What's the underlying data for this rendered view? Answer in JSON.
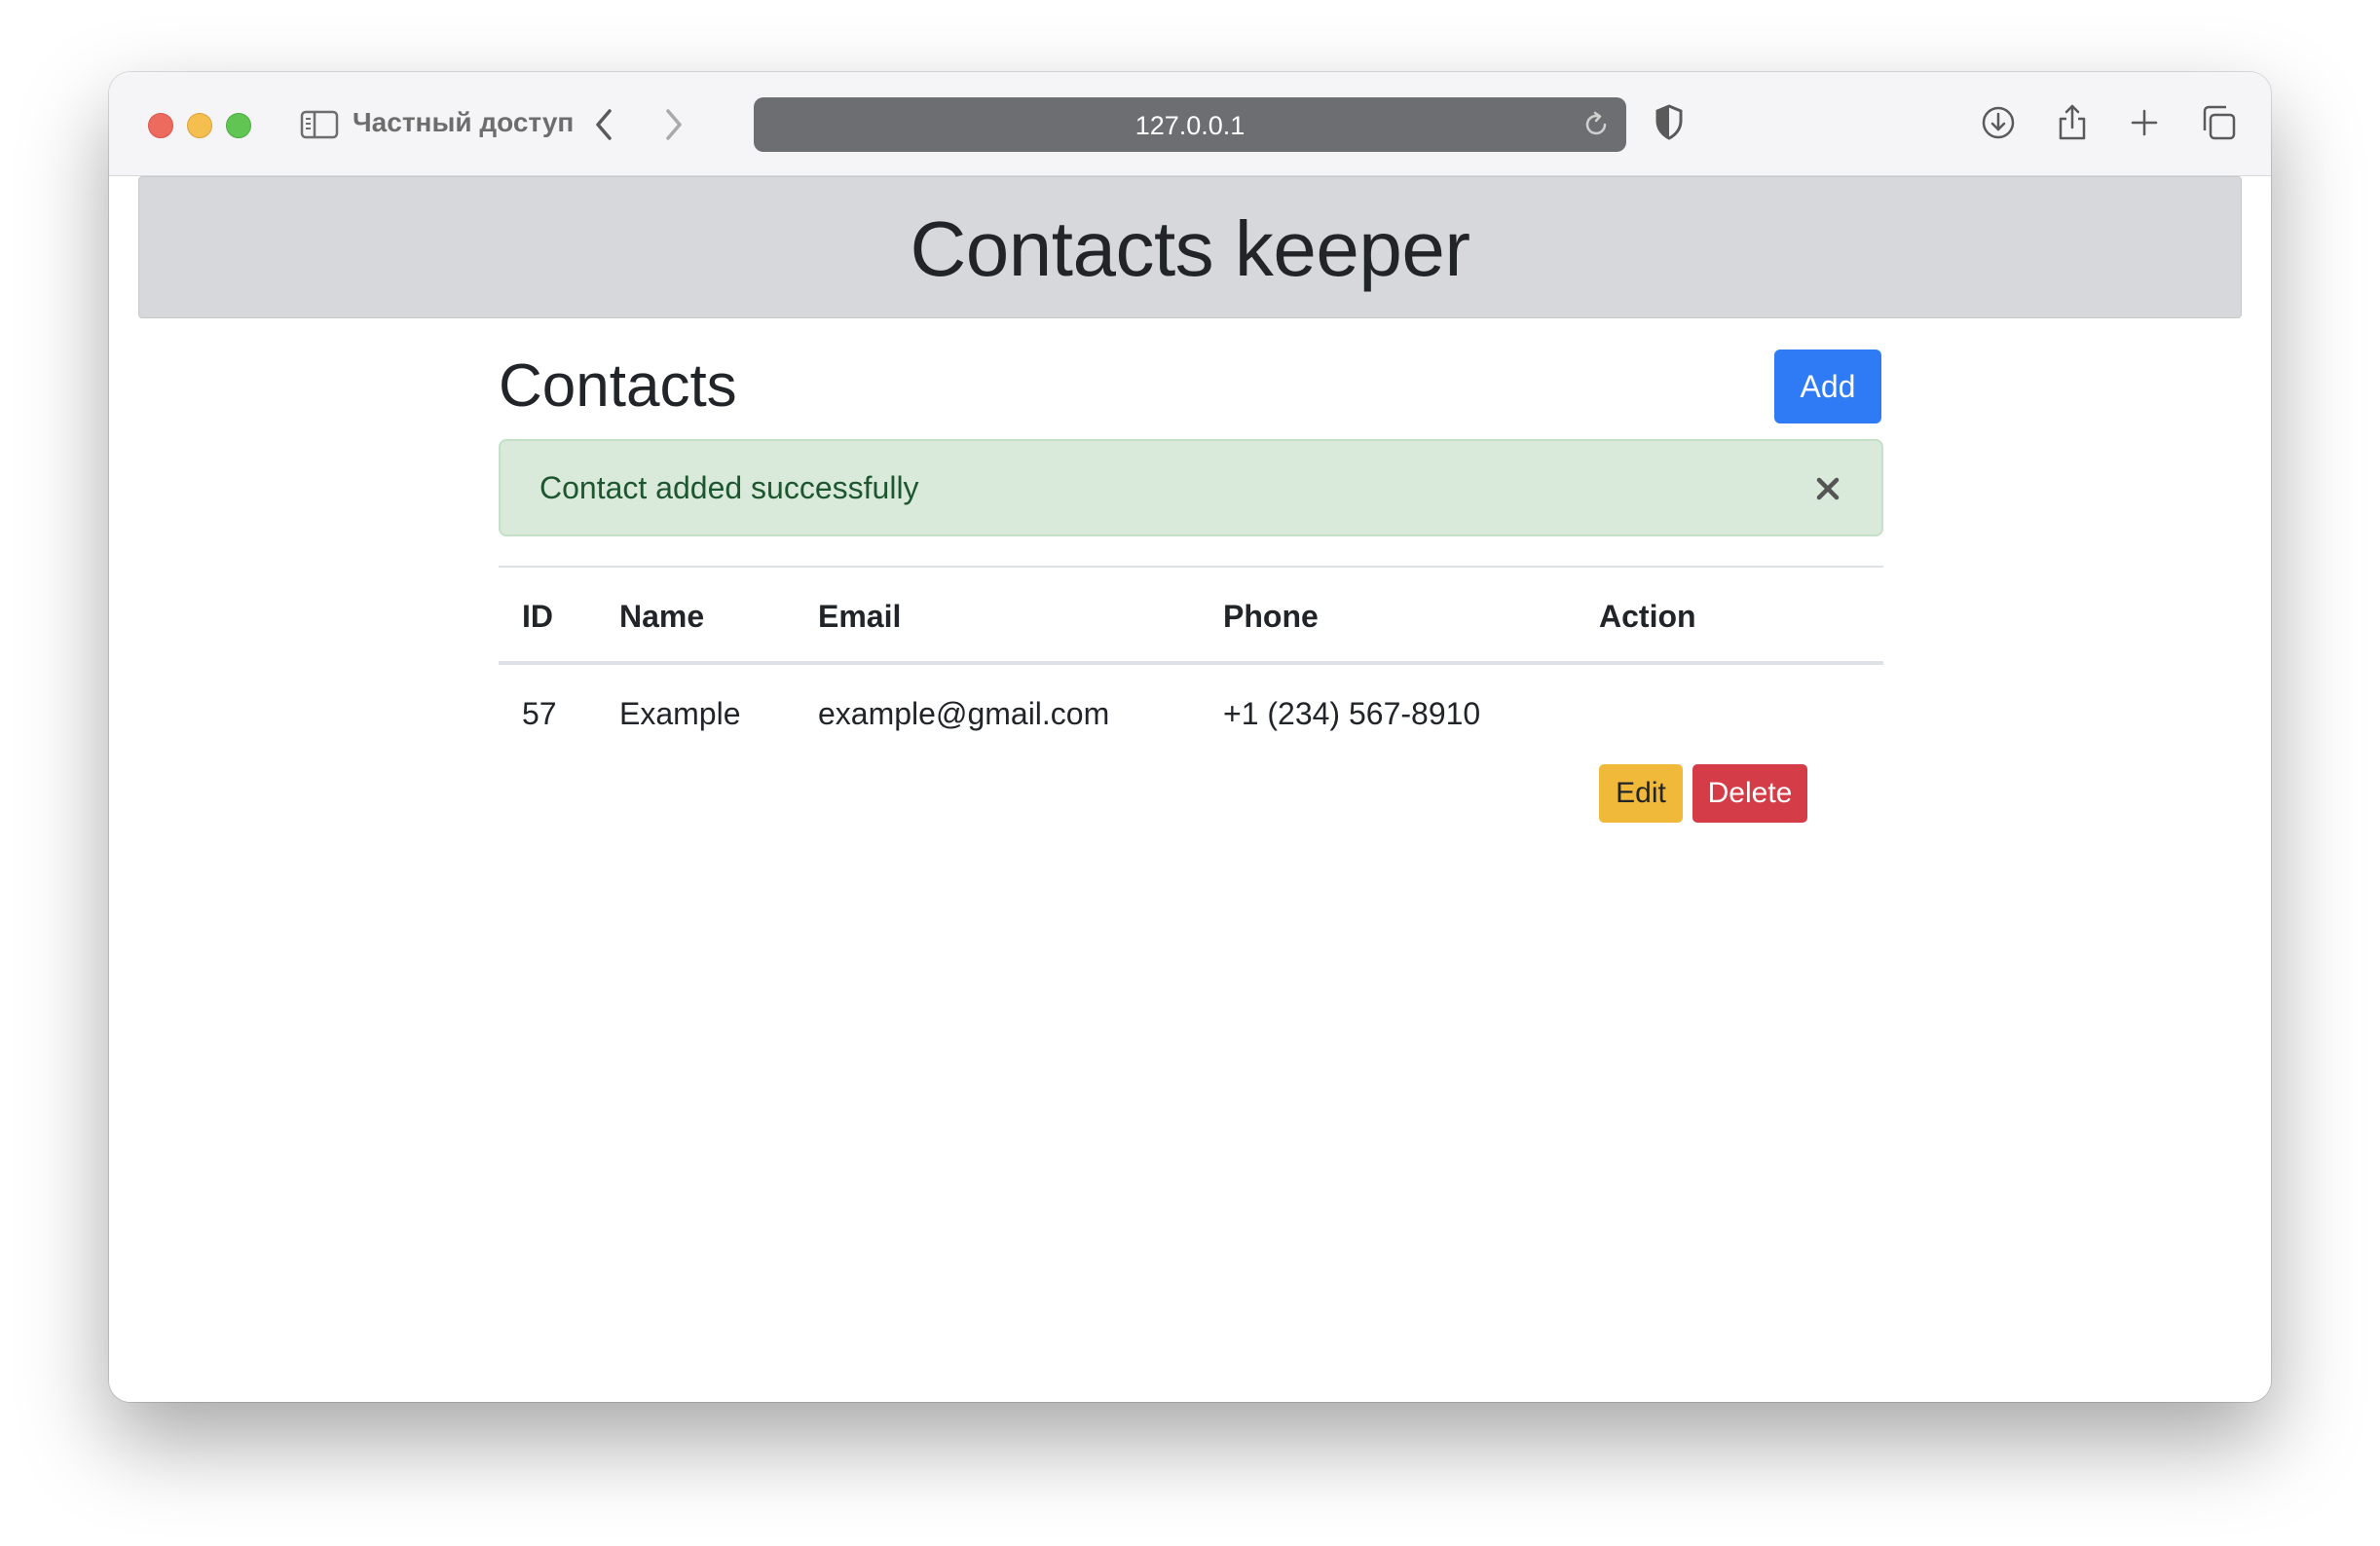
{
  "browser": {
    "private_label": "Частный доступ",
    "url": "127.0.0.1",
    "icons": [
      "sidebar-icon",
      "chevron-left-icon",
      "chevron-right-icon",
      "reload-icon",
      "shield-icon",
      "download-icon",
      "share-icon",
      "plus-icon",
      "tabs-icon"
    ]
  },
  "header": {
    "title": "Contacts keeper"
  },
  "main": {
    "heading": "Contacts",
    "add_label": "Add",
    "alert": {
      "text": "Contact added successfully"
    },
    "table": {
      "columns": [
        "ID",
        "Name",
        "Email",
        "Phone",
        "Action"
      ],
      "rows": [
        {
          "id": "57",
          "name": "Example",
          "email": "example@gmail.com",
          "phone": "+1 (234) 567-8910",
          "edit_label": "Edit",
          "delete_label": "Delete"
        }
      ]
    }
  },
  "colors": {
    "primary": "#2f7bf5",
    "warning": "#f0b93a",
    "danger": "#d43d47",
    "success_bg": "#d9eadb",
    "header_bg": "#d6d8db"
  }
}
